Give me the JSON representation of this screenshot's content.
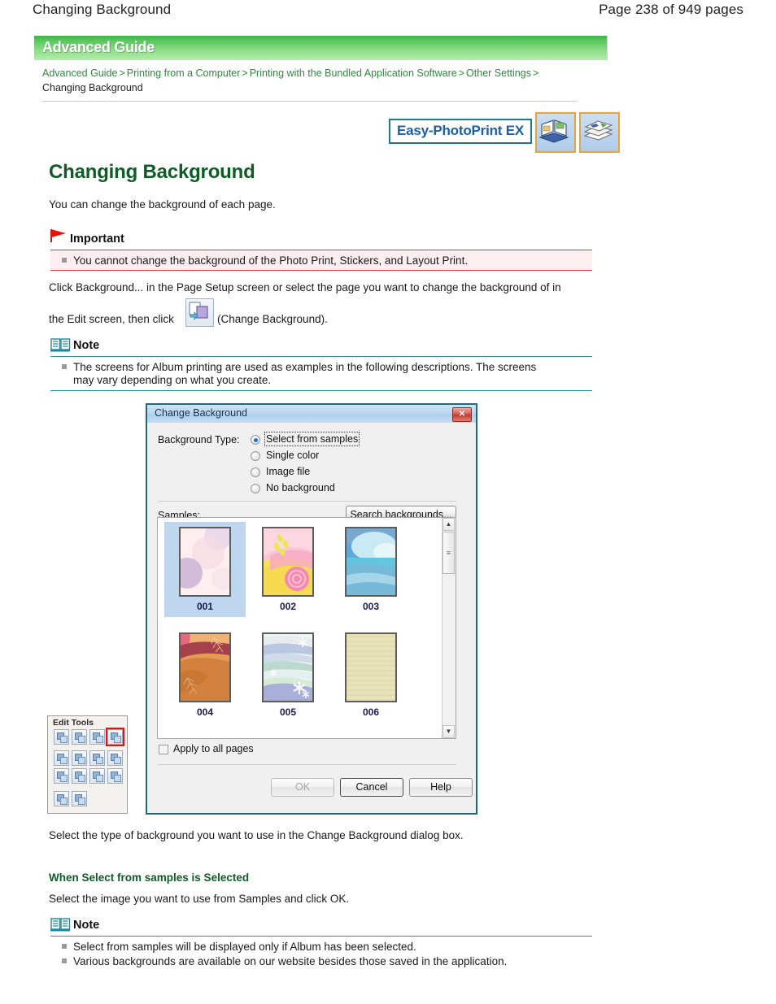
{
  "header": {
    "doc_title": "Changing Background",
    "page_indicator": "Page 238 of 949 pages"
  },
  "banner": {
    "label": "Advanced Guide"
  },
  "breadcrumb": {
    "items": [
      {
        "label": "Advanced Guide",
        "link": true
      },
      {
        "label": "Printing from a Computer",
        "link": true
      },
      {
        "label": "Printing with the Bundled Application Software",
        "link": true
      },
      {
        "label": "Other Settings",
        "link": true
      },
      {
        "label": "Changing Background",
        "link": false
      }
    ],
    "separator": ">"
  },
  "logo": {
    "product_name": "Easy-PhotoPrint EX",
    "tile1_icon": "open-album-book-icon",
    "tile2_icon": "stacked-photos-icon"
  },
  "main": {
    "title": "Changing Background",
    "intro": "You can change the background of each page.",
    "important": {
      "icon": "red-flag-icon",
      "title": "Important",
      "items": [
        "You cannot change the background of the Photo Print, Stickers, and Layout Print."
      ]
    },
    "instruction_line1": "Click Background... in the Page Setup screen or select the page you want to change the background of in",
    "instruction_line2_before": "the Edit screen, then click",
    "instruction_icon": "change-background-icon",
    "instruction_line2_after": "(Change Background).",
    "note1": {
      "icon": "open-book-icon",
      "title": "Note",
      "items": [
        "The screens for Album printing are used as examples in the following descriptions. The screens",
        "may vary depending on what you create."
      ]
    },
    "after_dialog_text": "Select the type of background you want to use in the Change Background dialog box.",
    "section_heading": "When Select from samples is Selected",
    "section_text": "Select the image you want to use from Samples and click OK.",
    "note2": {
      "icon": "open-book-icon",
      "title": "Note",
      "items": [
        "Select from samples will be displayed only if Album has been selected.",
        "Various backgrounds are available on our website besides those saved in the application."
      ]
    }
  },
  "dialog": {
    "title": "Change Background",
    "close_label": "✕",
    "background_type_label": "Background Type:",
    "radios": [
      {
        "label": "Select from samples",
        "selected": true,
        "focused": true
      },
      {
        "label": "Single color",
        "selected": false,
        "focused": false
      },
      {
        "label": "Image file",
        "selected": false,
        "focused": false
      },
      {
        "label": "No background",
        "selected": false,
        "focused": false
      }
    ],
    "samples_label": "Samples:",
    "search_button": "Search backgrounds...",
    "samples": [
      {
        "id": "001",
        "selected": true
      },
      {
        "id": "002",
        "selected": false
      },
      {
        "id": "003",
        "selected": false
      },
      {
        "id": "004",
        "selected": false
      },
      {
        "id": "005",
        "selected": false
      },
      {
        "id": "006",
        "selected": false
      }
    ],
    "scrollbar": {
      "up_arrow": "▲",
      "down_arrow": "▼",
      "thumb_grip": "≡"
    },
    "apply_all_label": "Apply to all pages",
    "apply_all_checked": false,
    "buttons": [
      {
        "label": "OK",
        "disabled": true,
        "default": false
      },
      {
        "label": "Cancel",
        "disabled": false,
        "default": true
      },
      {
        "label": "Help",
        "disabled": false,
        "default": false
      }
    ]
  },
  "palette": {
    "title": "Edit Tools",
    "tools": [
      {
        "name": "rotate-page-tool",
        "active": false
      },
      {
        "name": "zoom-tool",
        "active": false
      },
      {
        "name": "layout-tool",
        "active": false
      },
      {
        "name": "change-background-tool",
        "active": true
      },
      {
        "name": "add-image-tool",
        "active": false
      },
      {
        "name": "edit-image-tool",
        "active": false
      },
      {
        "name": "swap-image-tool",
        "active": false
      },
      {
        "name": "correct-image-tool",
        "active": false
      },
      {
        "name": "add-page-tool",
        "active": false
      },
      {
        "name": "duplicate-page-tool",
        "active": false
      },
      {
        "name": "frame-tool",
        "active": false
      },
      {
        "name": "palette-color-tool",
        "active": false
      },
      {
        "name": "add-text-tool",
        "active": false
      },
      {
        "name": "edit-text-tool",
        "active": false
      }
    ]
  },
  "colors": {
    "banner_green": "#3bb54a",
    "heading_green": "#0d5c25",
    "link_green": "#2c8a3b",
    "important_red": "#d03b3b",
    "note_teal": "#2a8fa0",
    "selection_blue": "#bfd6ef",
    "tool_active_red": "#e8120d"
  }
}
